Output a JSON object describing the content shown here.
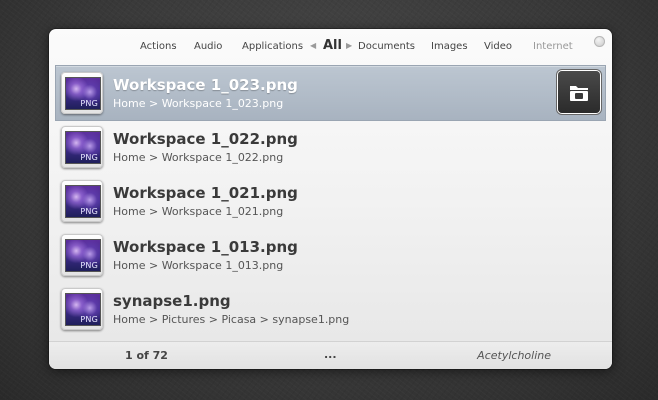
{
  "categories": {
    "items": [
      "Actions",
      "Audio",
      "Applications",
      "All",
      "Documents",
      "Images",
      "Video",
      "Internet"
    ],
    "selected": "All"
  },
  "results": [
    {
      "title": "Workspace 1_023.png",
      "path": "Home > Workspace 1_023.png",
      "thumb_label": "PNG",
      "icon": "png-file-icon",
      "selected": true
    },
    {
      "title": "Workspace 1_022.png",
      "path": "Home > Workspace 1_022.png",
      "thumb_label": "PNG",
      "icon": "png-file-icon"
    },
    {
      "title": "Workspace 1_021.png",
      "path": "Home > Workspace 1_021.png",
      "thumb_label": "PNG",
      "icon": "png-file-icon"
    },
    {
      "title": "Workspace 1_013.png",
      "path": "Home > Workspace 1_013.png",
      "thumb_label": "PNG",
      "icon": "png-file-icon"
    },
    {
      "title": "synapse1.png",
      "path": "Home > Pictures > Picasa > synapse1.png",
      "thumb_label": "PNG",
      "icon": "png-file-icon"
    }
  ],
  "action": {
    "icon": "open-folder-icon"
  },
  "footer": {
    "count": "1 of 72",
    "more": "...",
    "theme": "Acetylcholine"
  },
  "colors": {
    "selection": "#b0bac6",
    "panel": "#f2f2f2",
    "background": "#3a3a3a"
  }
}
